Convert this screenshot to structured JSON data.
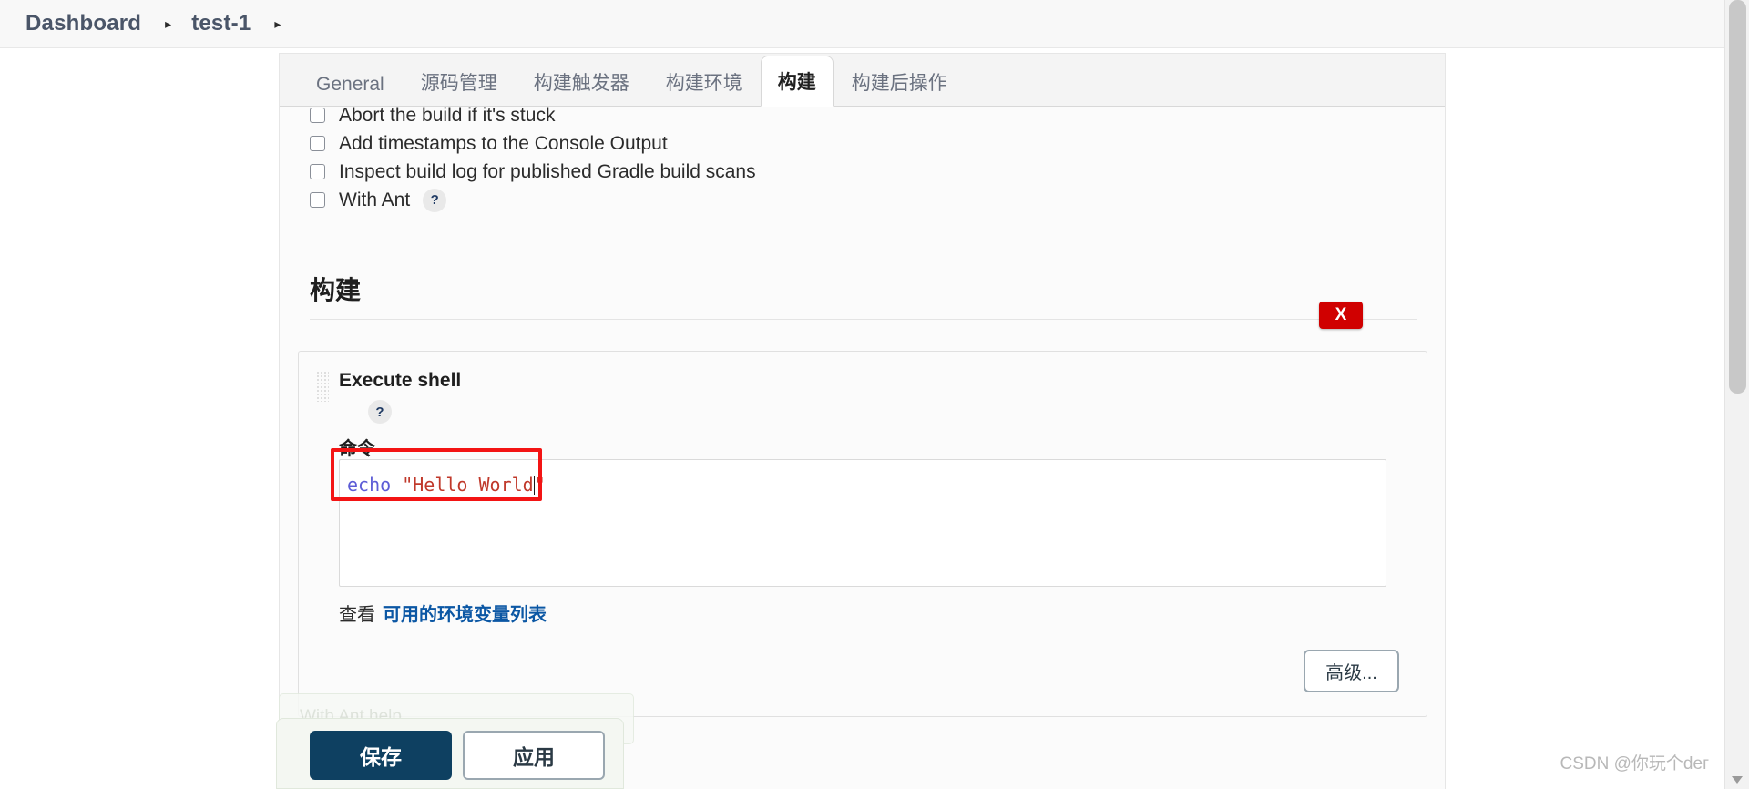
{
  "breadcrumb": {
    "items": [
      {
        "label": "Dashboard"
      },
      {
        "label": "test-1"
      }
    ],
    "separator": "▸"
  },
  "tabs": [
    {
      "label": "General",
      "active": false
    },
    {
      "label": "源码管理",
      "active": false
    },
    {
      "label": "构建触发器",
      "active": false
    },
    {
      "label": "构建环境",
      "active": false
    },
    {
      "label": "构建",
      "active": true
    },
    {
      "label": "构建后操作",
      "active": false
    }
  ],
  "checkboxes": [
    {
      "label": "Abort the build if it's stuck",
      "checked": false,
      "help": false
    },
    {
      "label": "Add timestamps to the Console Output",
      "checked": false,
      "help": false
    },
    {
      "label": "Inspect build log for published Gradle build scans",
      "checked": false,
      "help": false
    },
    {
      "label": "With Ant",
      "checked": false,
      "help": true
    }
  ],
  "help_glyph": "?",
  "build_section": {
    "title": "构建"
  },
  "builder": {
    "title": "Execute shell",
    "command_label": "命令",
    "command_tokens": {
      "command": "echo ",
      "string": "\"Hello World\""
    },
    "command_value": "echo \"Hello World\"",
    "env_prefix": "查看",
    "env_link": "可用的环境变量列表",
    "advanced_label": "高级...",
    "delete_label": "X"
  },
  "ghost_row": {
    "label": "With Ant help"
  },
  "save_bar": {
    "save_label": "保存",
    "apply_label": "应用"
  },
  "watermark": "CSDN @你玩个deг",
  "colors": {
    "accent_blue": "#0b57a4",
    "save_navy": "#0e4061",
    "danger_red": "#d00000",
    "annotation_red": "#f31414",
    "token_command": "#5c5cd6",
    "token_string": "#c0392b"
  }
}
